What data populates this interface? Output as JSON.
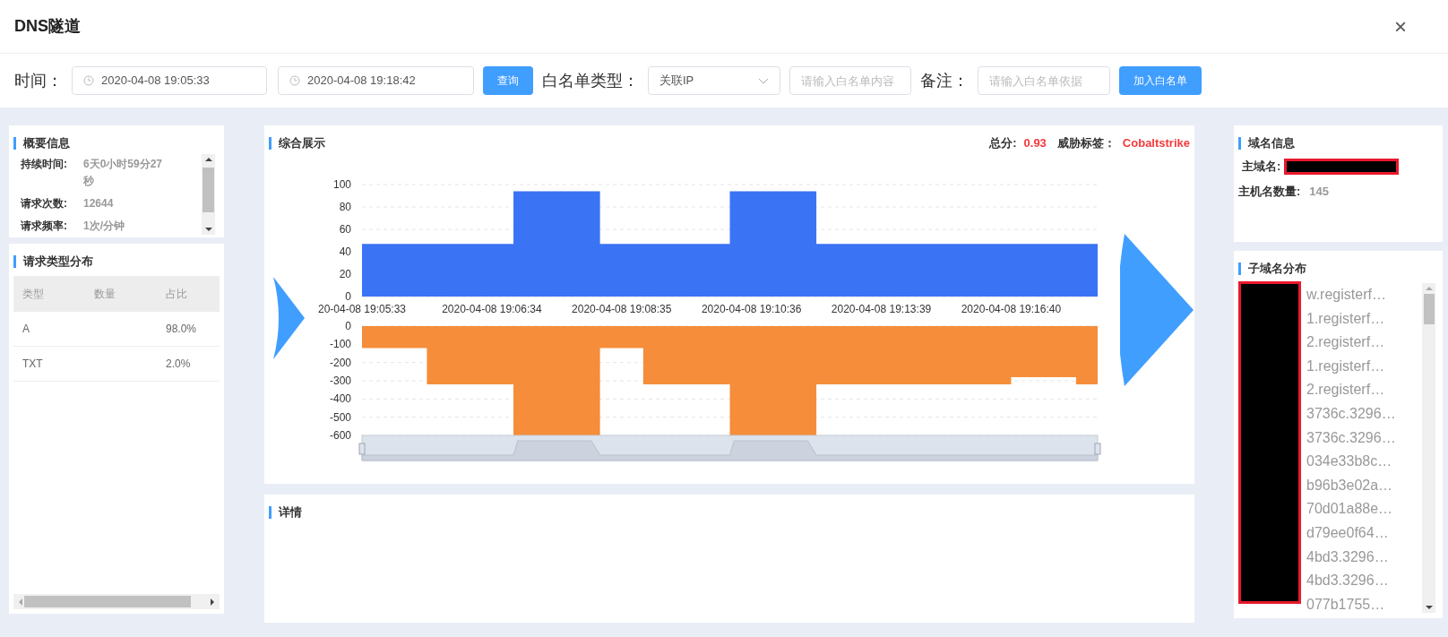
{
  "window": {
    "title": "DNS隧道",
    "close": "×"
  },
  "toolbar": {
    "time_label": "时间：",
    "start_time": "2020-04-08 19:05:33",
    "end_time": "2020-04-08 19:18:42",
    "query_button": "查询",
    "whitelist_type_label": "白名单类型：",
    "whitelist_type": "关联IP",
    "whitelist_content": {
      "placeholder": "请输入白名单内容"
    },
    "remark_label": "备注：",
    "remark": {
      "placeholder": "请输入白名单依据"
    },
    "add_button": "加入白名单"
  },
  "summary": {
    "title": "概要信息",
    "rows": [
      {
        "label": "持续时间:",
        "value": "6天0小时59分27秒"
      },
      {
        "label": "请求次数:",
        "value": "12644"
      },
      {
        "label": "请求频率:",
        "value": "1次/分钟"
      }
    ]
  },
  "request_types": {
    "title": "请求类型分布",
    "columns": [
      "类型",
      "数量",
      "占比"
    ],
    "rows": [
      [
        "A",
        "",
        "98.0%"
      ],
      [
        "TXT",
        "",
        "2.0%"
      ]
    ]
  },
  "overview": {
    "title": "综合展示",
    "score_label": "总分:",
    "score": "0.93",
    "tag_label": "威胁标签：",
    "tag": "Cobaltstrike",
    "charts": [
      {
        "chart_data": {
          "type": "area",
          "grid": true,
          "categories": [
            "20-04-08 19:05:33",
            null,
            null,
            null,
            null,
            null,
            "2020-04-08 19:06:34",
            null,
            null,
            null,
            null,
            null,
            "2020-04-08 19:08:35",
            null,
            null,
            null,
            null,
            null,
            "2020-04-08 19:10:36",
            null,
            null,
            null,
            null,
            null,
            "2020-04-08 19:13:39",
            null,
            null,
            null,
            null,
            null,
            "2020-04-08 19:16:40",
            null,
            null,
            null,
            null
          ],
          "series": [
            {
              "color": "#3b73f5",
              "values": [
                47,
                47,
                47,
                47,
                47,
                47,
                47,
                94,
                94,
                94,
                94,
                47,
                47,
                47,
                47,
                47,
                47,
                94,
                94,
                94,
                94,
                47,
                47,
                47,
                47,
                47,
                47,
                47,
                47,
                47,
                47,
                47,
                47,
                47,
                47
              ]
            }
          ],
          "ylim": [
            0,
            100
          ],
          "yticks": [
            0,
            20,
            40,
            60,
            80,
            100
          ]
        }
      },
      {
        "chart_data": {
          "type": "area",
          "grid": true,
          "series": [
            {
              "color": "#f58d3b",
              "values": [
                -120,
                -120,
                -120,
                -320,
                -320,
                -320,
                -320,
                -600,
                -600,
                -600,
                -600,
                -120,
                -120,
                -320,
                -320,
                -320,
                -320,
                -600,
                -600,
                -600,
                -600,
                -320,
                -320,
                -320,
                -320,
                -320,
                -320,
                -320,
                -320,
                -320,
                -280,
                -280,
                -280,
                -320,
                -320
              ]
            }
          ],
          "ylim": [
            -600,
            0
          ],
          "yticks": [
            0,
            -100,
            -200,
            -300,
            -400,
            -500,
            -600
          ]
        }
      }
    ]
  },
  "details": {
    "title": "详情"
  },
  "domain_info": {
    "title": "域名信息",
    "main_domain_label": "主域名:",
    "main_domain_redacted": true,
    "host_count_label": "主机名数量:",
    "host_count": "145"
  },
  "subdomains": {
    "title": "子域名分布",
    "redacted": true,
    "items": [
      "w.registerf…",
      "1.registerf…",
      "2.registerf…",
      "1.registerf…",
      "2.registerf…",
      "3736c.3296…",
      "3736c.3296…",
      "034e33b8c…",
      "b96b3e02a…",
      "70d01a88e…",
      "d79ee0f64…",
      "4bd3.3296…",
      "4bd3.3296…",
      "077b1755…"
    ]
  }
}
